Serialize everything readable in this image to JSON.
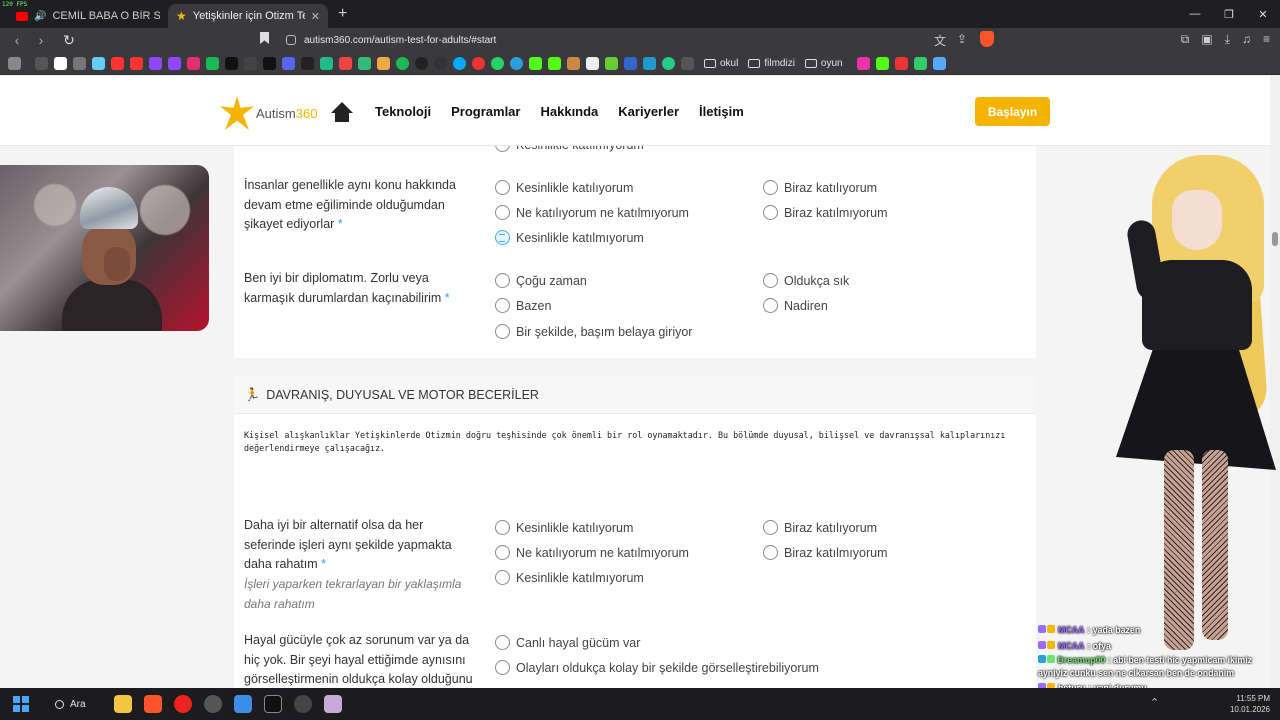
{
  "browser": {
    "fps": "120 FPS",
    "tabs": [
      {
        "title": "CEMİL BABA O BİR STAR- PAPAĞ"
      },
      {
        "title": "Yetişkinler için Otizm Testi - Yeti"
      }
    ],
    "url": "autism360.com/autism-test-for-adults/#start",
    "bookmark_folders": [
      "okul",
      "filmdizi",
      "oyun"
    ]
  },
  "site": {
    "logo_text": "Autism",
    "logo_number": "360",
    "menu": [
      "Teknoloji",
      "Programlar",
      "Hakkında",
      "Kariyerler",
      "İletişim"
    ],
    "cta": "Başlayın"
  },
  "questions": {
    "q0_tail": "Kesinlikle katılmıyorum",
    "q1": {
      "text": "İnsanlar genellikle aynı konu hakkında devam etme eğiliminde olduğumdan şikayet ediyorlar",
      "options": [
        "Kesinlikle katılıyorum",
        "Biraz katılıyorum",
        "Ne katılıyorum ne katılmıyorum",
        "Biraz katılmıyorum",
        "Kesinlikle katılmıyorum"
      ],
      "selected": 4
    },
    "q2": {
      "text": "Ben iyi bir diplomatım. Zorlu veya karmaşık durumlardan kaçınabilirim",
      "options": [
        "Çoğu zaman",
        "Oldukça sık",
        "Bazen",
        "Nadiren",
        "Bir şekilde, başım belaya giriyor"
      ]
    },
    "section": {
      "title": "DAVRANIŞ, DUYUSAL VE MOTOR BECERİLER",
      "description": "Kişisel alışkanlıklar Yetişkinlerde Otizmin doğru teşhisinde çok önemli bir rol oynamaktadır. Bu bölümde duyusal, bilişsel ve davranışsal kalıplarınızı değerlendirmeye çalışacağız."
    },
    "q3": {
      "text": "Daha iyi bir alternatif olsa da her seferinde işleri aynı şekilde yapmakta daha rahatım",
      "hint": "İşleri yaparken tekrarlayan bir yaklaşımla daha rahatım",
      "options": [
        "Kesinlikle katılıyorum",
        "Biraz katılıyorum",
        "Ne katılıyorum ne katılmıyorum",
        "Biraz katılmıyorum",
        "Kesinlikle katılmıyorum"
      ]
    },
    "q4": {
      "text": "Hayal gücüyle çok az sorunum var ya da hiç yok. Bir şeyi hayal ettiğimde aynısını görselleştirmenin oldukça kolay olduğunu",
      "options": [
        "Canlı hayal gücüm var",
        "Olayları oldukça kolay bir şekilde görselleştirebiliyorum"
      ]
    },
    "required_mark": "*"
  },
  "chat": [
    {
      "user": "MCAA",
      "msg": ": yada bazen"
    },
    {
      "user": "MCAA",
      "msg": ": ofya"
    },
    {
      "user": "Dreamup00",
      "msg": ": abi ben testi hic yapmicam ikimiz ayniyiz cunku sen ne cikarsan ben de ondanim"
    },
    {
      "user": "beturu",
      "msg": ": yani durumu"
    }
  ],
  "taskbar": {
    "search": "Ara",
    "time": "11:55 PM",
    "date": "10.01.2026"
  },
  "colors": {
    "accent": "#f4b400",
    "radio_selected": "#44aee0",
    "required": "#1aa3ff"
  }
}
